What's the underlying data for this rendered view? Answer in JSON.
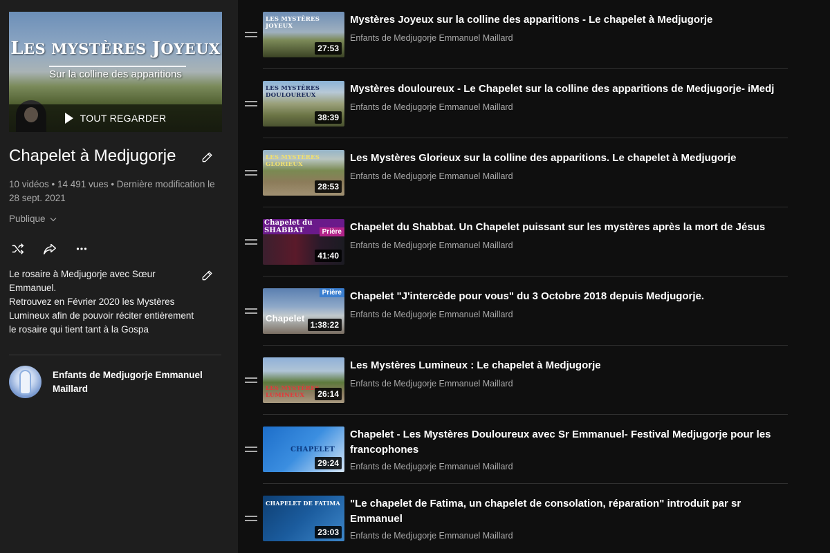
{
  "playlist": {
    "hero": {
      "title_first": "L",
      "title_small1": "ES MYSTÈRES ",
      "title_big2": "J",
      "title_small2": "OYEUX",
      "subtitle": "Sur la colline des apparitions",
      "play_all_label": "TOUT REGARDER"
    },
    "title": "Chapelet à Medjugorje",
    "stats": "10 vidéos • 14 491 vues • Dernière modification le 28 sept. 2021",
    "privacy": "Publique",
    "description": "Le rosaire à Medjugorje avec Sœur Emmanuel.\nRetrouvez en Février 2020 les Mystères Lumineux afin de pouvoir réciter entièrement le rosaire qui tient tant à la Gospa",
    "owner": "Enfants de Medjugorje Emmanuel Maillard"
  },
  "icons": {
    "edit": "pencil-icon",
    "shuffle": "shuffle-icon",
    "share": "share-icon",
    "more": "more-icon",
    "play": "play-icon",
    "chevron": "chevron-down-icon",
    "drag": "drag-handle-icon"
  },
  "videos": [
    {
      "title": "Mystères Joyeux sur la colline des apparitions - Le chapelet à Medjugorje",
      "channel": "Enfants de Medjugorje Emmanuel Maillard",
      "duration": "27:53",
      "thumb_text": "LES MYSTÈRES JOYEUX"
    },
    {
      "title": "Mystères douloureux - Le Chapelet sur la colline des apparitions de Medjugorje- iMedj",
      "channel": "Enfants de Medjugorje Emmanuel Maillard",
      "duration": "38:39",
      "thumb_text": "LES MYSTÈRES DOULOUREUX"
    },
    {
      "title": "Les Mystères Glorieux sur la colline des apparitions. Le chapelet à Medjugorje",
      "channel": "Enfants de Medjugorje Emmanuel Maillard",
      "duration": "28:53",
      "thumb_text": "LES MYSTÈRES GLORIEUX"
    },
    {
      "title": "Chapelet du Shabbat. Un Chapelet puissant sur les mystères après la mort de Jésus",
      "channel": "Enfants de Medjugorje Emmanuel Maillard",
      "duration": "41:40",
      "thumb_text": "Chapelet du SHABBAT",
      "badge": "Prière"
    },
    {
      "title": "Chapelet \"J'intercède pour vous\" du 3 Octobre 2018 depuis Medjugorje.",
      "channel": "Enfants de Medjugorje Emmanuel Maillard",
      "duration": "1:38:22",
      "thumb_text": "Chapelet",
      "badge": "Prière"
    },
    {
      "title": "Les Mystères Lumineux : Le chapelet à Medjugorje",
      "channel": "Enfants de Medjugorje Emmanuel Maillard",
      "duration": "26:14",
      "thumb_text": "LES MYSTÈRES LUMINEUX"
    },
    {
      "title": "Chapelet - Les Mystères Douloureux avec Sr Emmanuel- Festival Medjugorje pour les francophones",
      "channel": "Enfants de Medjugorje Emmanuel Maillard",
      "duration": "29:24",
      "thumb_text": "CHAPELET"
    },
    {
      "title": "\"Le chapelet de Fatima, un chapelet de consolation, réparation\" introduit par sr Emmanuel",
      "channel": "Enfants de Medjugorje Emmanuel Maillard",
      "duration": "23:03",
      "thumb_text": "CHAPELET DE FATIMA"
    }
  ]
}
